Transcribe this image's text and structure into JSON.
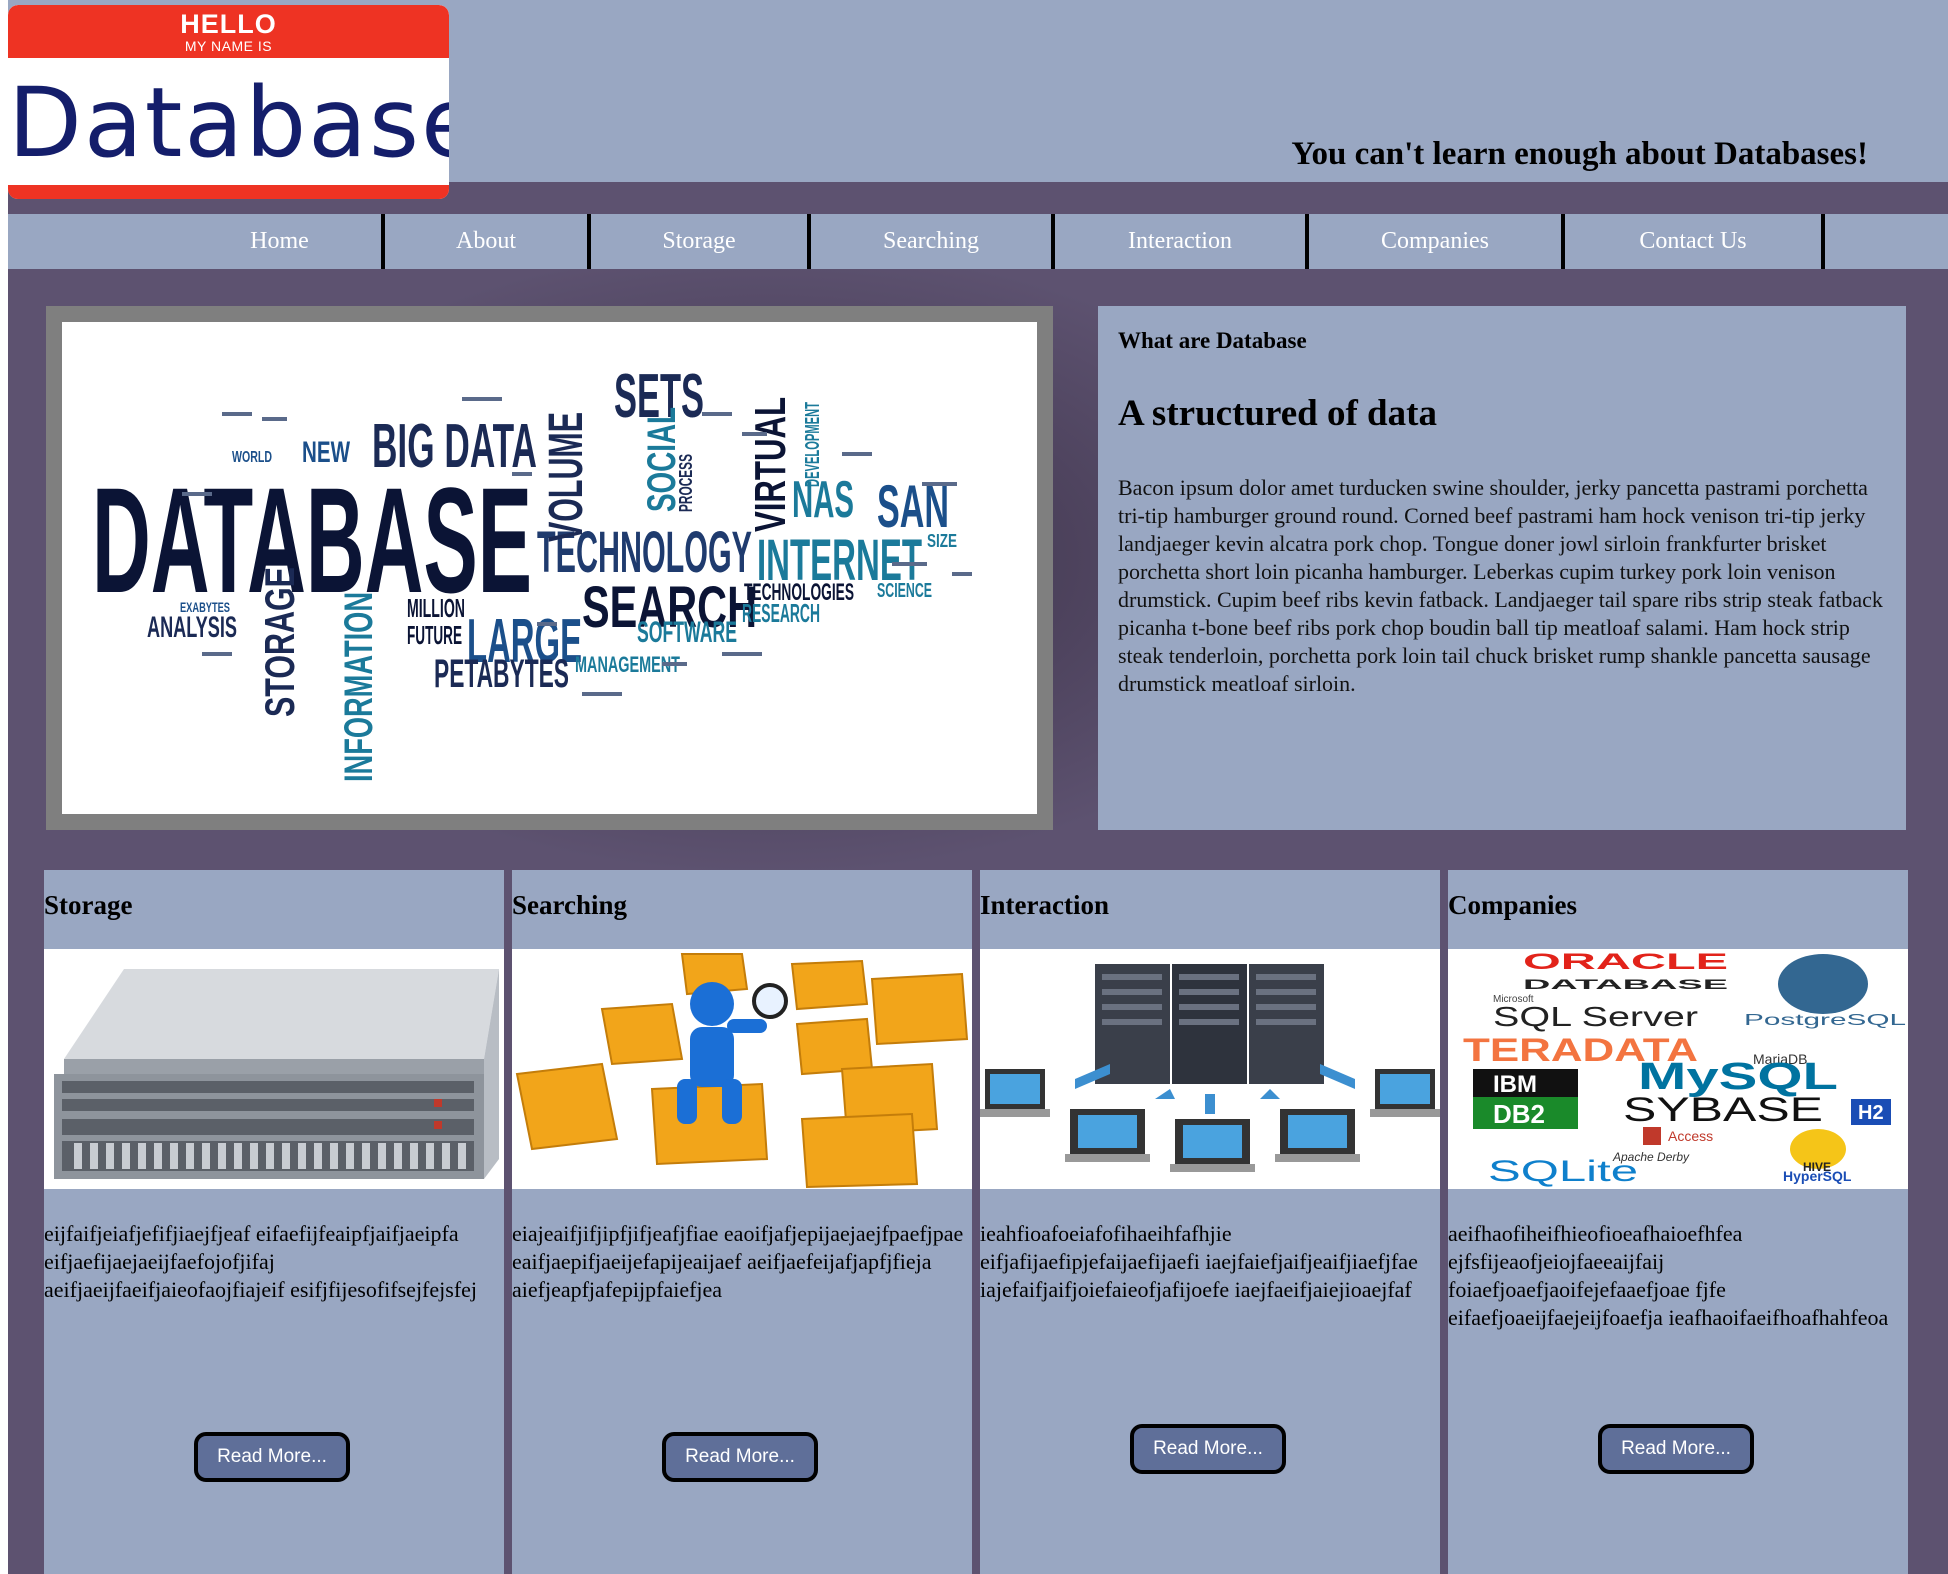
{
  "logo": {
    "hello": "HELLO",
    "my_name_is": "MY NAME IS",
    "name": "Database"
  },
  "tagline": "You can't learn enough about Databases!",
  "nav": [
    "Home",
    "About",
    "Storage",
    "Searching",
    "Interaction",
    "Companies",
    "Contact Us"
  ],
  "hero_image": {
    "words": [
      "DATABASE",
      "BIG DATA",
      "SETS",
      "VOLUME",
      "SOCIAL",
      "VIRTUAL",
      "TECHNOLOGY",
      "INTERNET",
      "NAS",
      "SAN",
      "SEARCH",
      "LARGE",
      "STORAGE",
      "INFORMATION",
      "PETABYTES",
      "MILLION",
      "FUTURE",
      "ANALYSIS",
      "SOFTWARE",
      "RESEARCH",
      "TECHNOLOGIES",
      "MANAGEMENT",
      "NEW",
      "WORLD",
      "SCIENCE",
      "EXABYTES",
      "DEVELOPMENT",
      "SIZE",
      "PROCESS"
    ]
  },
  "info": {
    "kicker": "What are Database",
    "heading": "A structured of data",
    "body": "Bacon ipsum dolor amet turducken swine shoulder, jerky pancetta pastrami porchetta tri-tip hamburger ground round. Corned beef pastrami ham hock venison tri-tip jerky landjaeger kevin alcatra pork chop. Tongue doner jowl sirloin frankfurter brisket porchetta short loin picanha hamburger. Leberkas cupim turkey pork loin venison drumstick. Cupim beef ribs kevin fatback. Landjaeger tail spare ribs strip steak fatback picanha t-bone beef ribs pork chop boudin ball tip meatloaf salami. Ham hock strip steak tenderloin, porchetta pork loin tail chuck brisket rump shankle pancetta sausage drumstick meatloaf sirloin."
  },
  "cards": [
    {
      "title": "Storage",
      "text": "eijfaifjeiafjefifjiaejfjeaf eifaefijfeaipfjaifjaeipfa eifjaefijaejaeijfaefojofjifaj aeifjaeijfaeifjaieofaojfiajeif esifjfijesofifsejfejsfej",
      "button": "Read More..."
    },
    {
      "title": "Searching",
      "text": "eiajeaifjifjipfjifjeafjfiae eaoifjafjepijaejaejfpaefjpae eaifjaepifjaeijefapijeaijaef aeifjaefeijafjapfjfieja aiefjeapfjafepijpfaiefjea",
      "button": "Read More..."
    },
    {
      "title": "Interaction",
      "text": "ieahfioafoeiafofihaeihfafhjie eifjafijaefipjefaijaefijaefi iaejfaiefjaifjeaifjiaefjfae iajefaifjaifjoiefaieofjafijoefe iaejfaeifjaiejioaejfaf",
      "button": "Read More..."
    },
    {
      "title": "Companies",
      "text": "aeifhaofiheifhieofioeafhaioefhfea ejfsfijeaofjeiojfaeeaijfaij foiaefjoaefjaoifejefaaefjoae fjfe eifaefjoaeijfaejeijfoaefja ieafhaoifaeifhoafhahfeoa",
      "button": "Read More...",
      "logos": [
        "ORACLE",
        "DATABASE",
        "Microsoft",
        "SQL Server",
        "PostgreSQL",
        "TERADATA",
        "MariaDB",
        "IBM",
        "DB2",
        "MySQL",
        "SYBASE",
        "H2",
        "Access",
        "Apache Derby",
        "HIVE",
        "SQLite",
        "HyperSQL"
      ]
    }
  ],
  "colors": {
    "panel": "#99a7c2",
    "page": "#5d5270",
    "logo_red": "#ee3323",
    "logo_text": "#141e6b",
    "button": "#5f6f99"
  }
}
